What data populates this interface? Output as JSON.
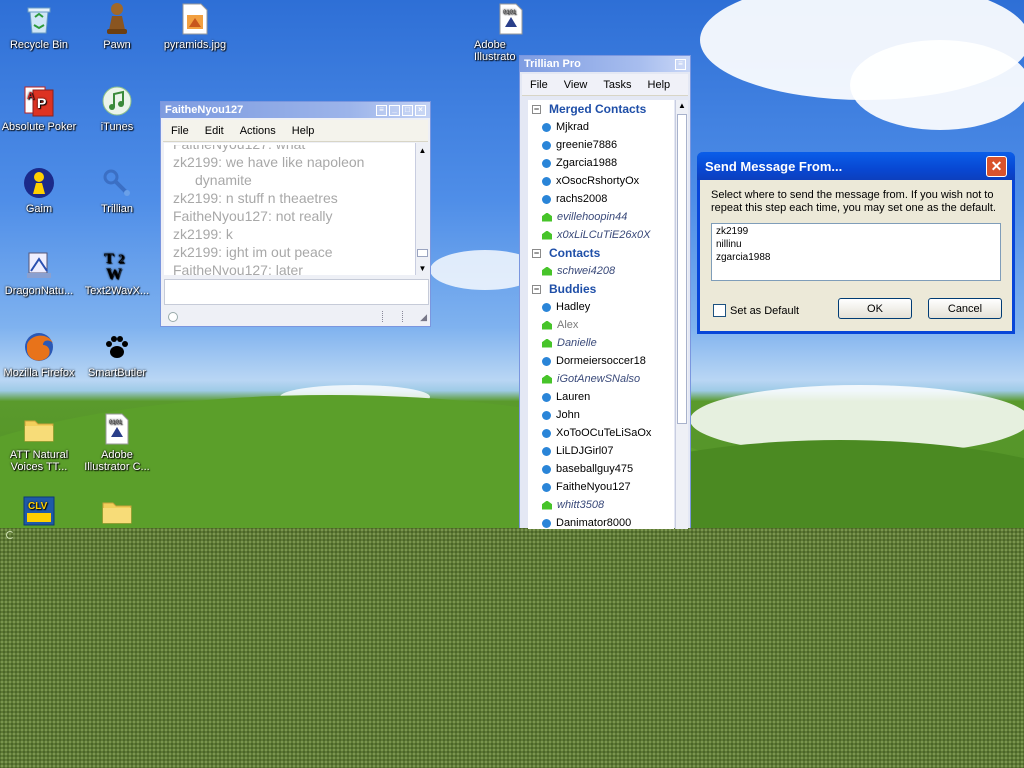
{
  "desktop": {
    "icons": [
      {
        "label": "Recycle Bin",
        "icon": "recycle-bin-icon"
      },
      {
        "label": "Pawn",
        "icon": "pawn-icon"
      },
      {
        "label": "pyramids.jpg",
        "icon": "image-file-icon"
      },
      {
        "label": "Adobe Illustrato",
        "icon": "illustrator-file-icon"
      },
      {
        "label": "Absolute Poker",
        "icon": "poker-icon"
      },
      {
        "label": "iTunes",
        "icon": "itunes-icon"
      },
      {
        "label": "Gaim",
        "icon": "gaim-icon"
      },
      {
        "label": "Trillian",
        "icon": "trillian-icon"
      },
      {
        "label": "DragonNatu...",
        "icon": "dragon-icon"
      },
      {
        "label": "Text2WavX...",
        "icon": "text2wav-icon"
      },
      {
        "label": "Mozilla Firefox",
        "icon": "firefox-icon"
      },
      {
        "label": "SmartButler",
        "icon": "paw-icon"
      },
      {
        "label": "ATT Natural Voices TT...",
        "icon": "folder-icon"
      },
      {
        "label": "Adobe Illustrator C...",
        "icon": "illustrator-file-icon"
      },
      {
        "label": "",
        "icon": "clv-icon"
      },
      {
        "label": "",
        "icon": "folder-icon"
      }
    ]
  },
  "chat": {
    "title": "FaitheNyou127",
    "menu": [
      "File",
      "Edit",
      "Actions",
      "Help"
    ],
    "messages": [
      "FaitheNyou127: what",
      "zk2199: we have like napoleon",
      "dynamite",
      "zk2199: n stuff n theaetres",
      "FaitheNyou127: not really",
      "zk2199: k",
      "zk2199: ight im out peace",
      "FaitheNyou127: later"
    ],
    "input_value": ""
  },
  "trillian": {
    "title": "Trillian Pro",
    "menu": [
      "File",
      "View",
      "Tasks",
      "Help"
    ],
    "groups": [
      {
        "name": "Merged Contacts",
        "contacts": [
          {
            "name": "Mjkrad",
            "status": "online"
          },
          {
            "name": "greenie7886",
            "status": "online"
          },
          {
            "name": "Zgarcia1988",
            "status": "online"
          },
          {
            "name": "xOsocRshortyOx",
            "status": "online"
          },
          {
            "name": "rachs2008",
            "status": "online"
          },
          {
            "name": "evillehoopin44",
            "status": "away"
          },
          {
            "name": "x0xLiLCuTiE26x0X",
            "status": "away"
          }
        ]
      },
      {
        "name": "Contacts",
        "contacts": [
          {
            "name": "schwei4208",
            "status": "away"
          }
        ]
      },
      {
        "name": "Buddies",
        "contacts": [
          {
            "name": "Hadley",
            "status": "online"
          },
          {
            "name": "Alex",
            "status": "idle"
          },
          {
            "name": "Danielle",
            "status": "away"
          },
          {
            "name": "Dormeiersoccer18",
            "status": "online"
          },
          {
            "name": "iGotAnewSNalso",
            "status": "away"
          },
          {
            "name": "Lauren",
            "status": "online"
          },
          {
            "name": "John",
            "status": "online"
          },
          {
            "name": "XoToOCuTeLiSaOx",
            "status": "online"
          },
          {
            "name": "LiLDJGirl07",
            "status": "online"
          },
          {
            "name": "baseballguy475",
            "status": "online"
          },
          {
            "name": "FaitheNyou127",
            "status": "online"
          },
          {
            "name": "whitt3508",
            "status": "away"
          },
          {
            "name": "Danimator8000",
            "status": "online"
          }
        ]
      }
    ]
  },
  "dialog": {
    "title": "Send Message From...",
    "instructions": "Select where to send the message from.  If you wish not to repeat this step each time, you may set one as the default.",
    "accounts": [
      "zk2199",
      "nillinu",
      "zgarcia1988"
    ],
    "set_default_label": "Set as Default",
    "ok_label": "OK",
    "cancel_label": "Cancel"
  }
}
